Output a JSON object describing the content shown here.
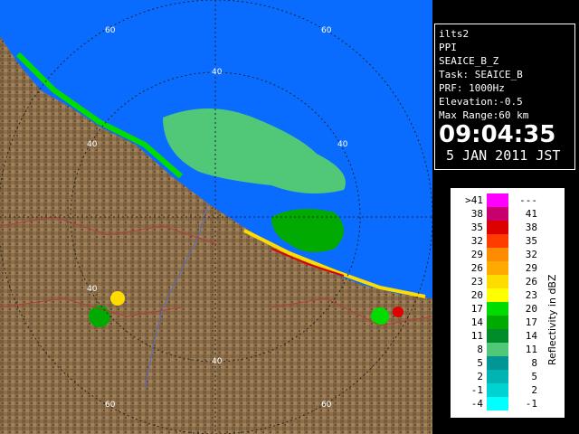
{
  "info": {
    "lines": [
      "ilts2",
      "PPI",
      "SEAICE_B_Z",
      "Task: SEAICE_B",
      "PRF: 1000Hz",
      "Elevation:-0.5",
      "Max Range:60 km"
    ],
    "time": "09:04:35",
    "date": "5 JAN 2011 JST"
  },
  "range_ring_labels": [
    {
      "label": "60"
    },
    {
      "label": "40"
    },
    {
      "label": "60"
    },
    {
      "label": "40"
    },
    {
      "label": "40"
    },
    {
      "label": "40"
    },
    {
      "label": "40"
    },
    {
      "label": "60"
    },
    {
      "label": "60"
    }
  ],
  "legend": {
    "title": "Reflectivity in dBZ",
    "rows": [
      {
        "lo": ">41",
        "hi": "---",
        "color": "#ff00ff"
      },
      {
        "lo": "38",
        "hi": "41",
        "color": "#c8006e"
      },
      {
        "lo": "35",
        "hi": "38",
        "color": "#dc0000"
      },
      {
        "lo": "32",
        "hi": "35",
        "color": "#ff3c00"
      },
      {
        "lo": "29",
        "hi": "32",
        "color": "#ff8c00"
      },
      {
        "lo": "26",
        "hi": "29",
        "color": "#ffaa00"
      },
      {
        "lo": "23",
        "hi": "26",
        "color": "#ffdc00"
      },
      {
        "lo": "20",
        "hi": "23",
        "color": "#ffff00"
      },
      {
        "lo": "17",
        "hi": "20",
        "color": "#00dc00"
      },
      {
        "lo": "14",
        "hi": "17",
        "color": "#00aa00"
      },
      {
        "lo": "11",
        "hi": "14",
        "color": "#008c2a"
      },
      {
        "lo": "8",
        "hi": "11",
        "color": "#50c878"
      },
      {
        "lo": "5",
        "hi": "8",
        "color": "#009696"
      },
      {
        "lo": "2",
        "hi": "5",
        "color": "#00b4b4"
      },
      {
        "lo": "-1",
        "hi": "2",
        "color": "#00d2d2"
      },
      {
        "lo": "-4",
        "hi": "-1",
        "color": "#00ffff"
      }
    ]
  },
  "colors": {
    "sea": "#0a6cff",
    "land": "#8c6e4a",
    "rings": "#222222",
    "rivers": "#5a6cc8",
    "borders": "#b43c3c"
  }
}
